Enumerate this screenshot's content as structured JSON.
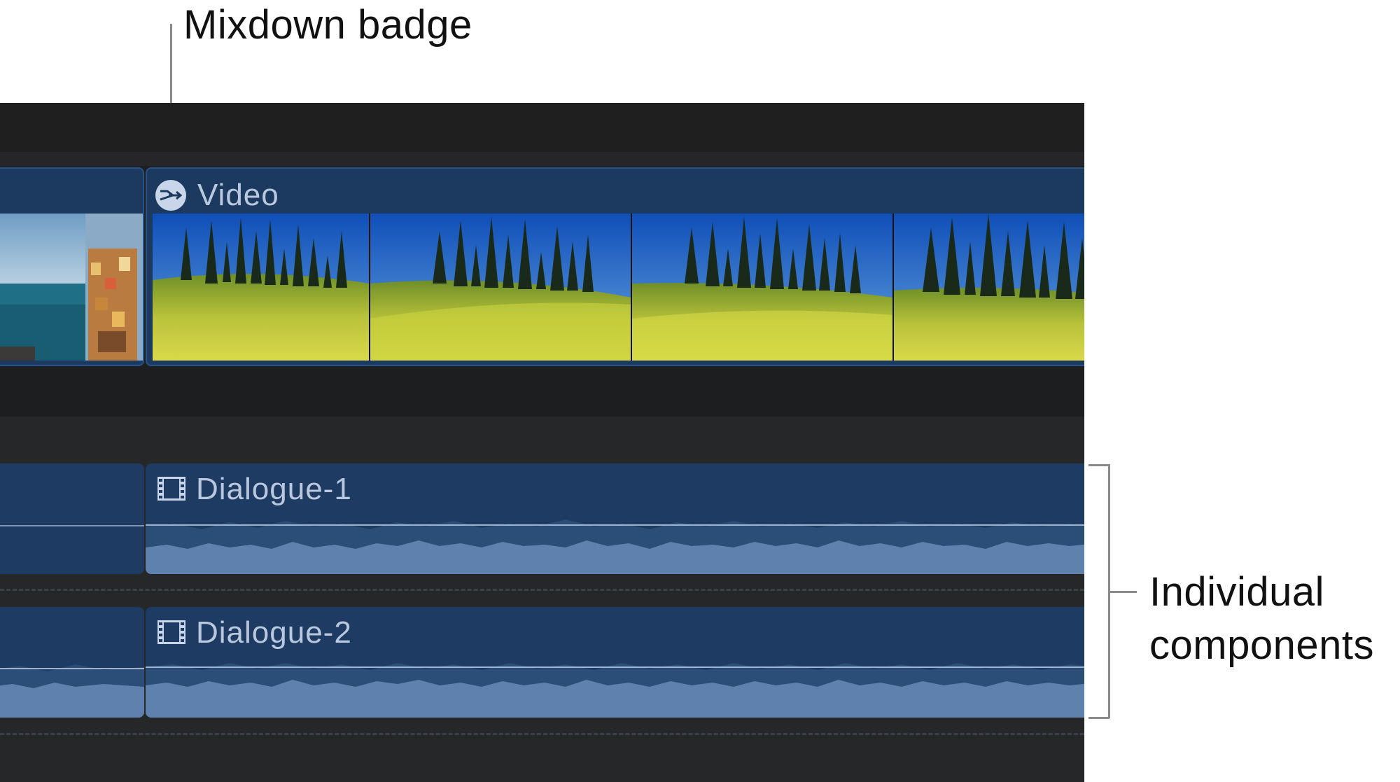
{
  "callouts": {
    "mixdown_badge": "Mixdown badge",
    "individual_line1": "Individual",
    "individual_line2": "components"
  },
  "timeline": {
    "video_clip_label": "Video",
    "audio_components": [
      {
        "label": "Dialogue-1"
      },
      {
        "label": "Dialogue-2"
      }
    ]
  },
  "icons": {
    "mixdown": "mixdown-badge-icon",
    "component": "film-strip-icon"
  },
  "colors": {
    "timeline_bg": "#232325",
    "clip_blue": "#1c3a5f",
    "waveform_fill": "#5e82ad",
    "label_text": "#b9c8de"
  }
}
